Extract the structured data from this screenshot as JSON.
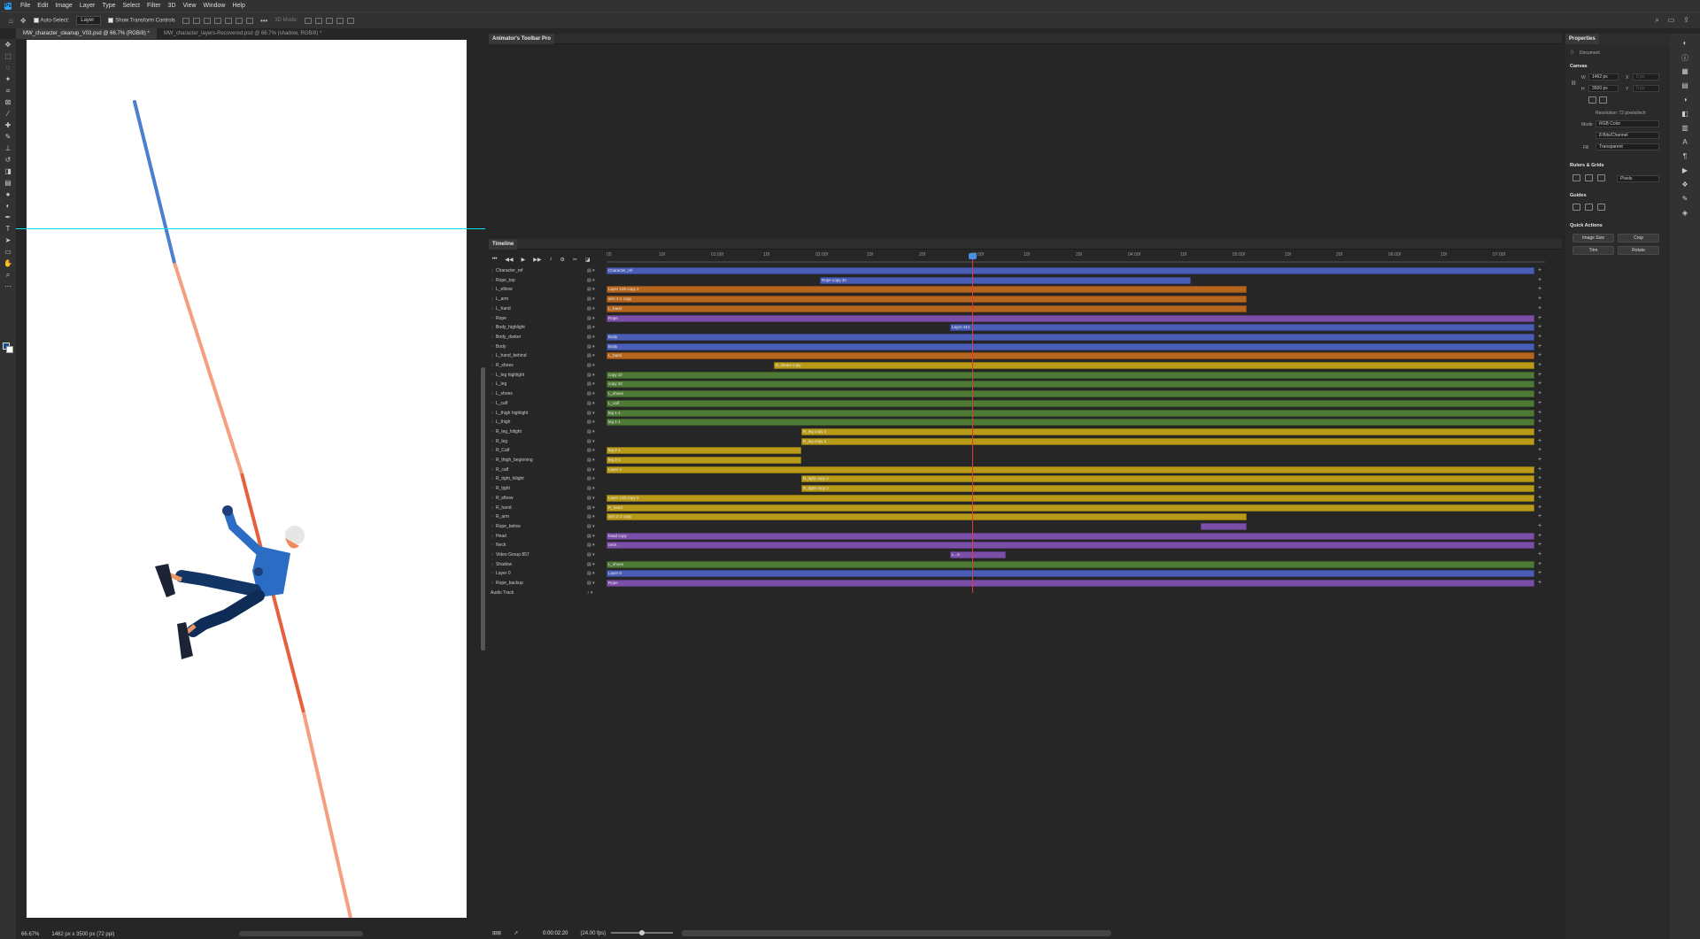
{
  "menubar": {
    "items": [
      "File",
      "Edit",
      "Image",
      "Layer",
      "Type",
      "Select",
      "Filter",
      "3D",
      "View",
      "Window",
      "Help"
    ],
    "logo": "Ps"
  },
  "options": {
    "auto_select_label": "Auto-Select:",
    "auto_select_value": "Layer",
    "transform_label": "Show Transform Controls",
    "mode_label": "3D Mode:"
  },
  "tabs": [
    {
      "label": "MW_character_cleanup_V03.psd @ 66.7% (RGB/8) *"
    },
    {
      "label": "MW_character_layers-Recovered.psd @ 66.7% (shadow, RGB/8) *"
    }
  ],
  "status": {
    "zoom": "66.67%",
    "doc_size": "1462 px x 3500 px (72 ppi)"
  },
  "animator_panel": {
    "title": "Animator's Toolbar Pro"
  },
  "timeline": {
    "title": "Timeline",
    "timecode": "0:00:02:20",
    "fps": "(24.00 fps)",
    "bottom_icon": "⊞⊞",
    "ruler": [
      "00",
      "10f",
      "01:00f",
      "10f",
      "02:00f",
      "10f",
      "20f",
      "03:00f",
      "10f",
      "20f",
      "04:00f",
      "10f",
      "05:00f",
      "10f",
      "20f",
      "06:00f",
      "10f",
      "07:00f"
    ],
    "audio_label": "Audio Track"
  },
  "layers": [
    {
      "name": "Character_ref",
      "color": "#4a5eb8",
      "clips": [
        {
          "s": 0,
          "e": 1.0,
          "t": "Character_ref"
        }
      ]
    },
    {
      "name": "Rope_top",
      "color": "#4a5eb8",
      "clips": [
        {
          "s": 0.23,
          "e": 0.63,
          "t": "Rope copy 40"
        }
      ]
    },
    {
      "name": "L_elbow",
      "color": "#b5651d",
      "clips": [
        {
          "s": 0,
          "e": 0.69,
          "t": "Layer 128 copy 2"
        }
      ]
    },
    {
      "name": "L_arm",
      "color": "#b5651d",
      "clips": [
        {
          "s": 0,
          "e": 0.69,
          "t": "arm 1-1 copy"
        }
      ]
    },
    {
      "name": "L_hand",
      "color": "#b5651d",
      "clips": [
        {
          "s": 0,
          "e": 0.69,
          "t": "L_hand"
        }
      ]
    },
    {
      "name": "Rope",
      "color": "#7b4fa8",
      "clips": [
        {
          "s": 0,
          "e": 1.0,
          "t": "Rope"
        }
      ]
    },
    {
      "name": "Body_highlight",
      "color": "#4a5eb8",
      "clips": [
        {
          "s": 0.37,
          "e": 1.0,
          "t": "Layer 444"
        }
      ]
    },
    {
      "name": "Body_darker",
      "color": "#4a5eb8",
      "clips": [
        {
          "s": 0,
          "e": 1.0,
          "t": "Body"
        }
      ]
    },
    {
      "name": "Body",
      "color": "#4a5eb8",
      "clips": [
        {
          "s": 0,
          "e": 1.0,
          "t": "Body"
        }
      ]
    },
    {
      "name": "L_hand_behind",
      "color": "#b5651d",
      "clips": [
        {
          "s": 0,
          "e": 1.0,
          "t": "L_hand"
        }
      ]
    },
    {
      "name": "R_shoes",
      "color": "#b89a18",
      "clips": [
        {
          "s": 0.18,
          "e": 1.0,
          "t": "R_shoes copy"
        }
      ]
    },
    {
      "name": "L_leg highlight",
      "color": "#4f7a35",
      "clips": [
        {
          "s": 0,
          "e": 1.0,
          "t": "copy 10"
        }
      ]
    },
    {
      "name": "L_leg",
      "color": "#4f7a35",
      "clips": [
        {
          "s": 0,
          "e": 1.0,
          "t": "copy 10"
        }
      ]
    },
    {
      "name": "L_shoes",
      "color": "#4f7a35",
      "clips": [
        {
          "s": 0,
          "e": 1.0,
          "t": "L_shoes"
        }
      ]
    },
    {
      "name": "L_calf",
      "color": "#4f7a35",
      "clips": [
        {
          "s": 0,
          "e": 1.0,
          "t": "L_calf"
        }
      ]
    },
    {
      "name": "L_thigh highlight",
      "color": "#4f7a35",
      "clips": [
        {
          "s": 0,
          "e": 1.0,
          "t": "leg 1-1"
        }
      ]
    },
    {
      "name": "L_thigh",
      "color": "#4f7a35",
      "clips": [
        {
          "s": 0,
          "e": 1.0,
          "t": "leg 1-1"
        }
      ]
    },
    {
      "name": "R_leg_hilight",
      "color": "#b89a18",
      "clips": [
        {
          "s": 0.21,
          "e": 1.0,
          "t": "R_leg copy 2"
        }
      ]
    },
    {
      "name": "R_leg",
      "color": "#b89a18",
      "clips": [
        {
          "s": 0.21,
          "e": 1.0,
          "t": "R_leg copy 2"
        }
      ]
    },
    {
      "name": "R_Calf",
      "color": "#b89a18",
      "clips": [
        {
          "s": 0,
          "e": 0.21,
          "t": "leg 2-1"
        }
      ]
    },
    {
      "name": "R_thigh_beginning",
      "color": "#b89a18",
      "clips": [
        {
          "s": 0,
          "e": 0.21,
          "t": "leg 2-1"
        }
      ]
    },
    {
      "name": "R_calf",
      "color": "#b89a18",
      "clips": [
        {
          "s": 0,
          "e": 1.0,
          "t": "Layer 4"
        }
      ]
    },
    {
      "name": "R_tight_hilight",
      "color": "#b89a18",
      "clips": [
        {
          "s": 0.21,
          "e": 1.0,
          "t": "R_tight copy 2"
        }
      ]
    },
    {
      "name": "R_tight",
      "color": "#b89a18",
      "clips": [
        {
          "s": 0.21,
          "e": 1.0,
          "t": "R_tight copy 2"
        }
      ]
    },
    {
      "name": "R_elbow",
      "color": "#b89a18",
      "clips": [
        {
          "s": 0,
          "e": 1.0,
          "t": "Layer 128 copy 5"
        }
      ]
    },
    {
      "name": "R_hand",
      "color": "#b89a18",
      "clips": [
        {
          "s": 0,
          "e": 1.0,
          "t": "R_hand"
        }
      ]
    },
    {
      "name": "R_arm",
      "color": "#b89a18",
      "clips": [
        {
          "s": 0,
          "e": 0.69,
          "t": "arm 2-1 copy"
        }
      ]
    },
    {
      "name": "Rope_below",
      "color": "#7b4fa8",
      "clips": [
        {
          "s": 0.64,
          "e": 0.69,
          "t": ""
        }
      ]
    },
    {
      "name": "Head",
      "color": "#7b4fa8",
      "clips": [
        {
          "s": 0,
          "e": 1.0,
          "t": "head copy"
        }
      ]
    },
    {
      "name": "Neck",
      "color": "#7b4fa8",
      "clips": [
        {
          "s": 0,
          "e": 1.0,
          "t": "neck"
        }
      ]
    },
    {
      "name": "Video Group 857",
      "color": "#7b4fa8",
      "clips": [
        {
          "s": 0.37,
          "e": 0.43,
          "t": "L...5"
        }
      ]
    },
    {
      "name": "Shadow",
      "color": "#4f7a35",
      "clips": [
        {
          "s": 0,
          "e": 1.0,
          "t": "L_shoes"
        }
      ]
    },
    {
      "name": "Layer 0",
      "color": "#4a5eb8",
      "clips": [
        {
          "s": 0,
          "e": 1.0,
          "t": "Layer 0"
        }
      ]
    },
    {
      "name": "Rope_backup",
      "color": "#7b4fa8",
      "clips": [
        {
          "s": 0,
          "e": 1.0,
          "t": "Rope"
        }
      ]
    }
  ],
  "properties": {
    "title": "Properties",
    "doc_label": "Document",
    "canvas_section": "Canvas",
    "w_label": "W",
    "w_value": "1462 px",
    "h_label": "H",
    "h_value": "3500 px",
    "x_label": "X",
    "x_value": "0 px",
    "y_label": "Y",
    "y_value": "0 px",
    "resolution": "Resolution: 72 pixels/inch",
    "mode_label": "Mode",
    "mode_value": "RGB Color",
    "depth_value": "8 Bits/Channel",
    "fill_label": "Fill",
    "fill_value": "Transparent",
    "rulers_section": "Rulers & Grids",
    "units_value": "Pixels",
    "guides_section": "Guides",
    "quick_section": "Quick Actions",
    "btn_image_size": "Image Size",
    "btn_crop": "Crop",
    "btn_trim": "Trim",
    "btn_rotate": "Rotate"
  }
}
